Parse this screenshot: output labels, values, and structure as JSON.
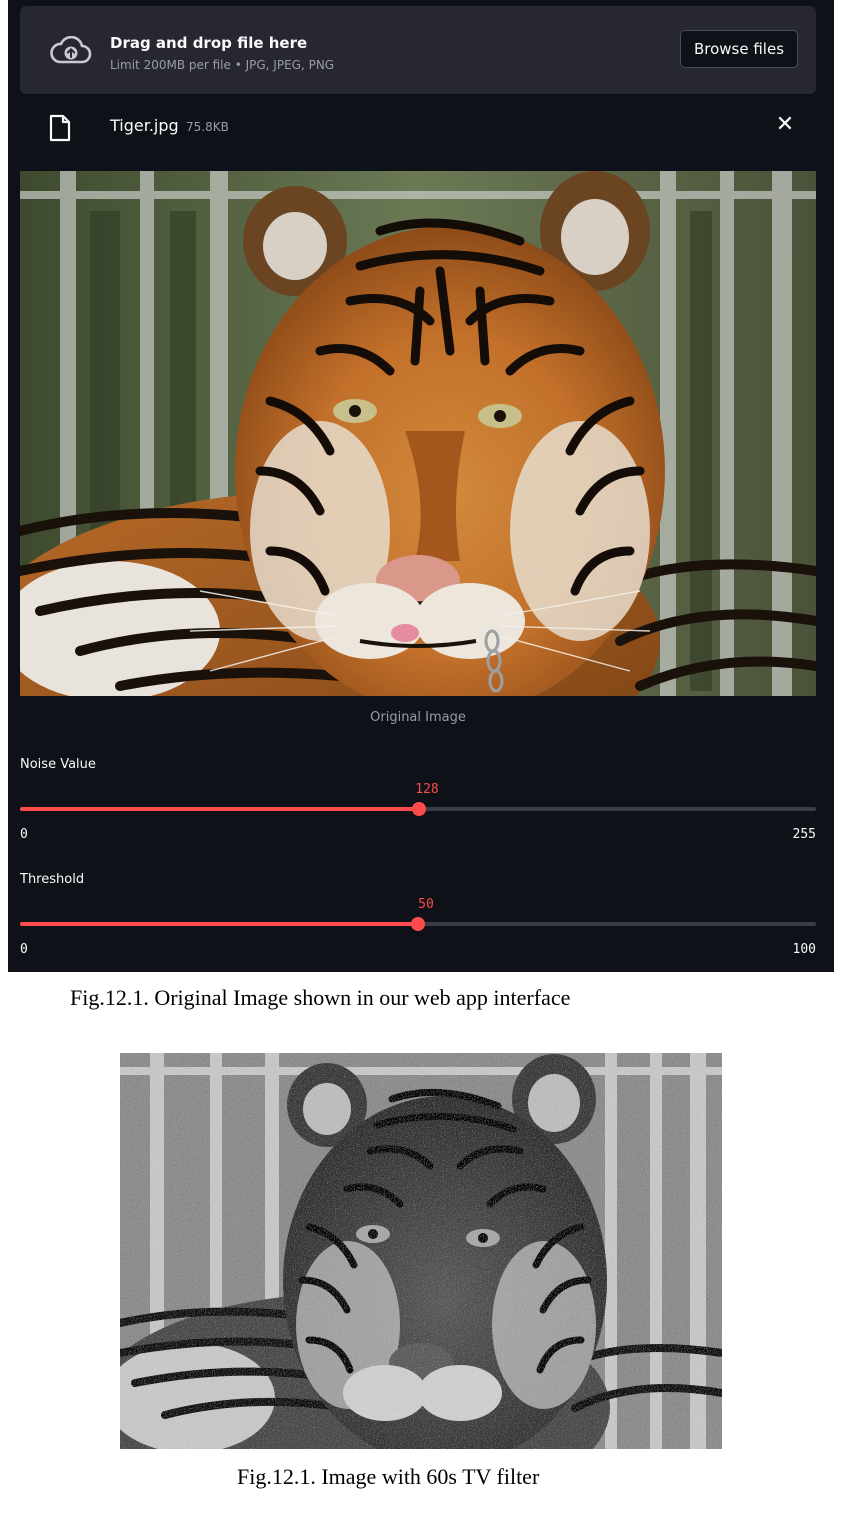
{
  "uploader": {
    "title": "Drag and drop file here",
    "limit_text": "Limit 200MB per file • JPG, JPEG, PNG",
    "browse_label": "Browse files",
    "icon": "cloud-upload-icon"
  },
  "file": {
    "name": "Tiger.jpg",
    "size": "75.8KB",
    "icon": "file-icon",
    "remove_icon": "close-icon"
  },
  "original_image": {
    "caption": "Original Image"
  },
  "sliders": [
    {
      "label": "Noise Value",
      "value": "128",
      "min": "0",
      "max": "255"
    },
    {
      "label": "Threshold",
      "value": "50",
      "min": "0",
      "max": "100"
    }
  ],
  "figures": {
    "caption_1": "Fig.12.1. Original Image shown in our web app interface",
    "caption_2": "Fig.12.1. Image with 60s TV filter"
  },
  "colors": {
    "app_background": "#0e1117",
    "dropzone_background": "#262730",
    "accent": "#ff4b4b",
    "text": "#fafafa",
    "muted_text": "#9a9ca6"
  }
}
